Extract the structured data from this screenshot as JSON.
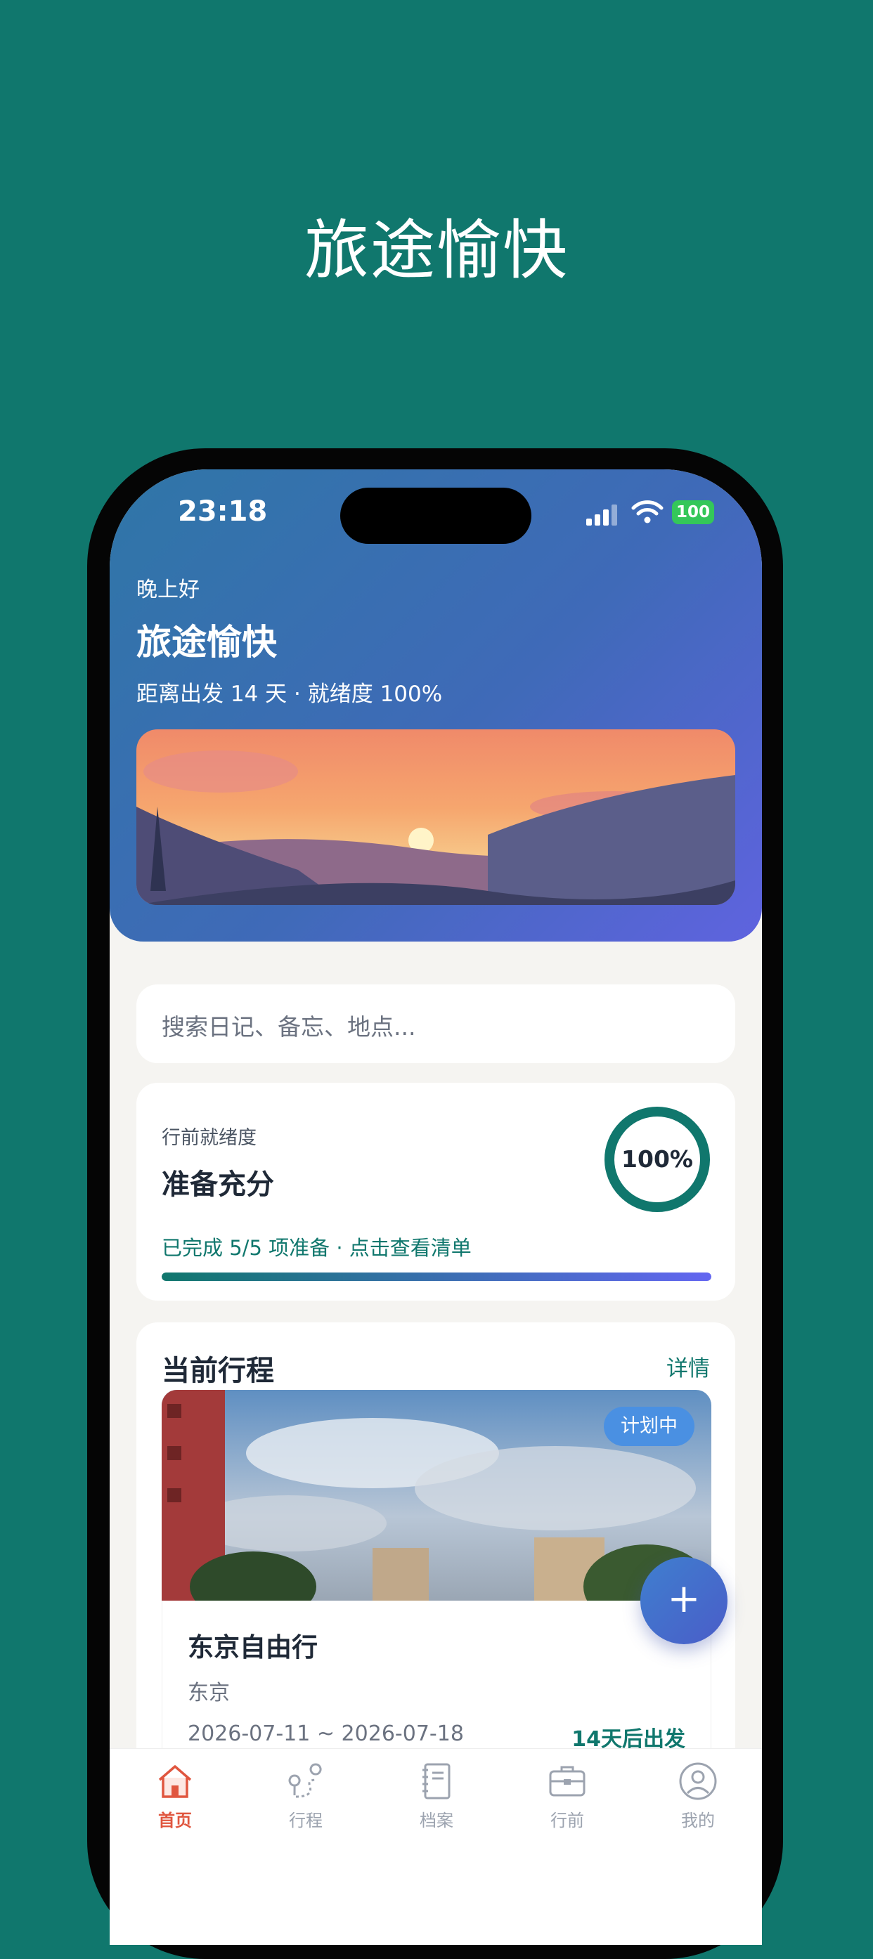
{
  "promo": {
    "title": "旅途愉快"
  },
  "status_bar": {
    "time": "23:18",
    "battery": "100"
  },
  "header": {
    "greeting": "晚上好",
    "title": "旅途愉快",
    "subtitle": "距离出发 14 天 · 就绪度 100%"
  },
  "search": {
    "placeholder": "搜索日记、备忘、地点..."
  },
  "readiness": {
    "label": "行前就绪度",
    "title": "准备充分",
    "percent_text": "100%",
    "percent": 100,
    "note": "已完成 5/5 项准备 · 点击查看清单",
    "progress": 1.0
  },
  "current_trip": {
    "header": "当前行程",
    "details_label": "详情",
    "status_badge": "计划中",
    "name": "东京自由行",
    "city": "东京",
    "dates": "2026-07-11 ~ 2026-07-18",
    "countdown": "14天后出发"
  },
  "fab": {
    "label": "+"
  },
  "tabs": [
    {
      "label": "首页",
      "icon": "home-icon",
      "active": true
    },
    {
      "label": "行程",
      "icon": "route-icon",
      "active": false
    },
    {
      "label": "档案",
      "icon": "notebook-icon",
      "active": false
    },
    {
      "label": "行前",
      "icon": "luggage-icon",
      "active": false
    },
    {
      "label": "我的",
      "icon": "user-icon",
      "active": false
    }
  ],
  "colors": {
    "background": "#10776d",
    "accent": "#10776d",
    "header_gradient_start": "#2f76a7",
    "header_gradient_end": "#5f63df",
    "active_tab": "#e0563f",
    "badge": "#4a90e2"
  }
}
